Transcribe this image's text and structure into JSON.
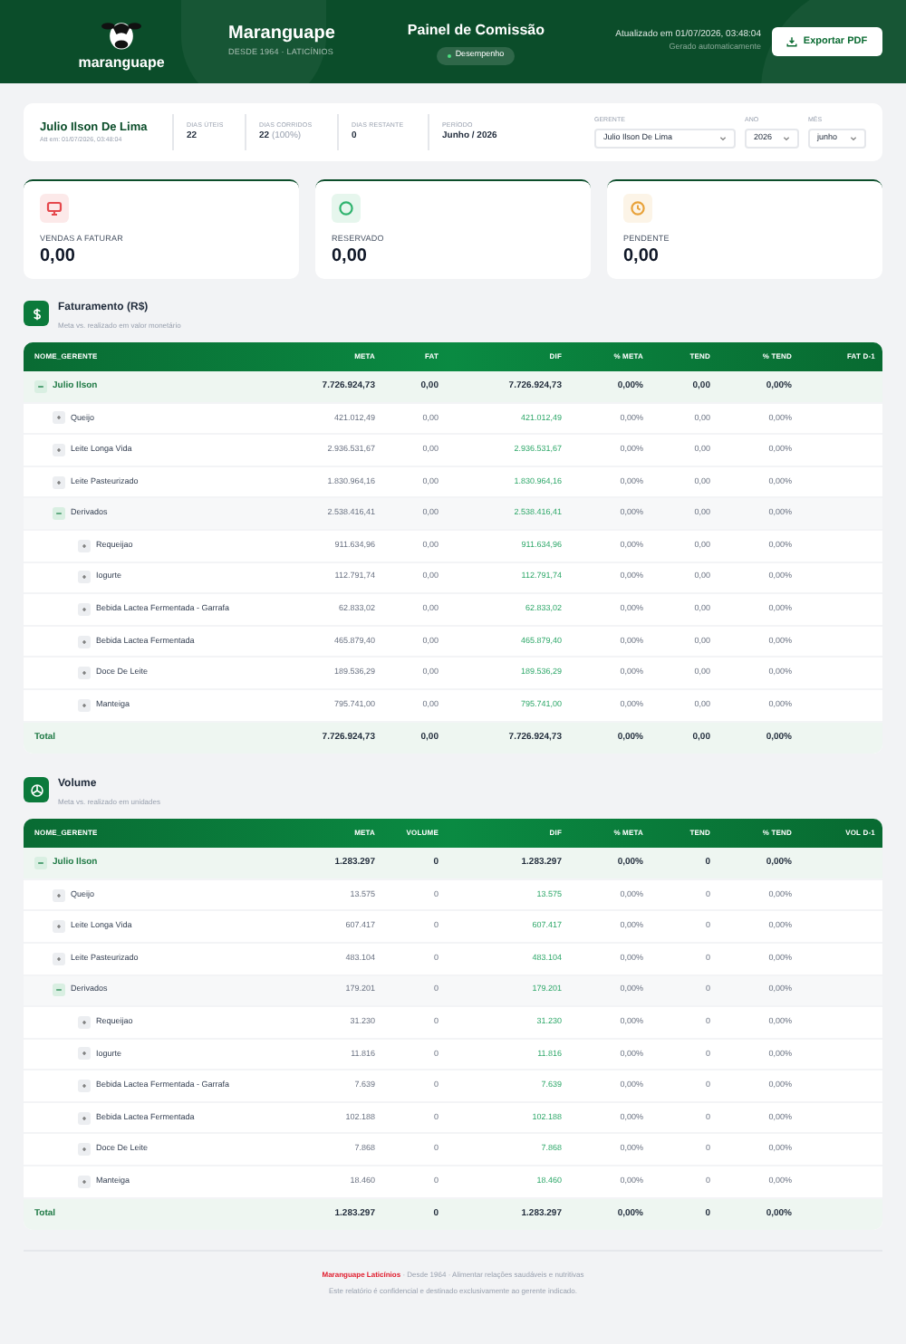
{
  "header": {
    "logo_text": "maranguape",
    "title": "Maranguape",
    "subtitle": "DESDE 1964 · LATICÍNIOS",
    "center_title": "Painel de Comissão",
    "pill": "Desempenho",
    "updated": "Atualizado em 01/07/2026, 03:48:04",
    "generated": "Gerado automaticamente",
    "export_button": "Exportar PDF"
  },
  "info": {
    "name": "Julio Ilson De Lima",
    "updated": "Att em: 01/07/2026, 03:48:04",
    "stats": [
      {
        "label": "DIAS ÚTEIS",
        "value": "22"
      },
      {
        "label": "DIAS CORRIDOS",
        "value": "22",
        "note": "(100%)"
      },
      {
        "label": "DIAS RESTANTE",
        "value": "0"
      },
      {
        "label": "PERÍODO",
        "value": "Junho / 2026"
      }
    ],
    "filters": [
      {
        "label": "GERENTE",
        "value": "Julio Ilson De Lima"
      },
      {
        "label": "ANO",
        "value": "2026"
      },
      {
        "label": "MÊS",
        "value": "junho"
      }
    ]
  },
  "kpis": [
    {
      "kind": "monitor",
      "color": "#e5484d",
      "label": "VENDAS A FATURAR",
      "value": "0,00"
    },
    {
      "kind": "circle",
      "color": "#2fb36e",
      "label": "RESERVADO",
      "value": "0,00"
    },
    {
      "kind": "clock",
      "color": "#e8a23a",
      "label": "PENDENTE",
      "value": "0,00"
    }
  ],
  "tables": [
    {
      "kind": "money",
      "title": "Faturamento (R$)",
      "subtitle": "Meta vs. realizado em valor monetário",
      "columns": [
        "NOME_GERENTE",
        "META",
        "FAT",
        "DIF",
        "% META",
        "TEND",
        "% TEND",
        "FAT D-1"
      ],
      "rows": [
        {
          "name": "Julio Ilson",
          "expanded": true,
          "values": [
            "7.726.924,73",
            "0,00",
            "7.726.924,73",
            "0,00%",
            "0,00",
            "0,00%"
          ],
          "children": [
            {
              "name": "Queijo",
              "expanded": false,
              "values": [
                "421.012,49",
                "0,00",
                "421.012,49",
                "0,00%",
                "0,00",
                "0,00%"
              ]
            },
            {
              "name": "Leite Longa Vida",
              "expanded": false,
              "values": [
                "2.936.531,67",
                "0,00",
                "2.936.531,67",
                "0,00%",
                "0,00",
                "0,00%"
              ]
            },
            {
              "name": "Leite Pasteurizado",
              "expanded": false,
              "values": [
                "1.830.964,16",
                "0,00",
                "1.830.964,16",
                "0,00%",
                "0,00",
                "0,00%"
              ]
            },
            {
              "name": "Derivados",
              "expanded": true,
              "values": [
                "2.538.416,41",
                "0,00",
                "2.538.416,41",
                "0,00%",
                "0,00",
                "0,00%"
              ],
              "children": [
                {
                  "name": "Requeijao",
                  "expanded": false,
                  "values": [
                    "911.634,96",
                    "0,00",
                    "911.634,96",
                    "0,00%",
                    "0,00",
                    "0,00%"
                  ]
                },
                {
                  "name": "Iogurte",
                  "expanded": false,
                  "values": [
                    "112.791,74",
                    "0,00",
                    "112.791,74",
                    "0,00%",
                    "0,00",
                    "0,00%"
                  ]
                },
                {
                  "name": "Bebida Lactea Fermentada - Garrafa",
                  "expanded": false,
                  "values": [
                    "62.833,02",
                    "0,00",
                    "62.833,02",
                    "0,00%",
                    "0,00",
                    "0,00%"
                  ]
                },
                {
                  "name": "Bebida Lactea Fermentada",
                  "expanded": false,
                  "values": [
                    "465.879,40",
                    "0,00",
                    "465.879,40",
                    "0,00%",
                    "0,00",
                    "0,00%"
                  ]
                },
                {
                  "name": "Doce De Leite",
                  "expanded": false,
                  "values": [
                    "189.536,29",
                    "0,00",
                    "189.536,29",
                    "0,00%",
                    "0,00",
                    "0,00%"
                  ]
                },
                {
                  "name": "Manteiga",
                  "expanded": false,
                  "values": [
                    "795.741,00",
                    "0,00",
                    "795.741,00",
                    "0,00%",
                    "0,00",
                    "0,00%"
                  ]
                }
              ]
            }
          ]
        }
      ],
      "total": {
        "label": "Total",
        "values": [
          "7.726.924,73",
          "0,00",
          "7.726.924,73",
          "0,00%",
          "0,00",
          "0,00%"
        ]
      }
    },
    {
      "kind": "volume",
      "title": "Volume",
      "subtitle": "Meta vs. realizado em unidades",
      "columns": [
        "NOME_GERENTE",
        "META",
        "VOLUME",
        "DIF",
        "% META",
        "TEND",
        "% TEND",
        "VOL D-1"
      ],
      "rows": [
        {
          "name": "Julio Ilson",
          "expanded": true,
          "values": [
            "1.283.297",
            "0",
            "1.283.297",
            "0,00%",
            "0",
            "0,00%"
          ],
          "children": [
            {
              "name": "Queijo",
              "expanded": false,
              "values": [
                "13.575",
                "0",
                "13.575",
                "0,00%",
                "0",
                "0,00%"
              ]
            },
            {
              "name": "Leite Longa Vida",
              "expanded": false,
              "values": [
                "607.417",
                "0",
                "607.417",
                "0,00%",
                "0",
                "0,00%"
              ]
            },
            {
              "name": "Leite Pasteurizado",
              "expanded": false,
              "values": [
                "483.104",
                "0",
                "483.104",
                "0,00%",
                "0",
                "0,00%"
              ]
            },
            {
              "name": "Derivados",
              "expanded": true,
              "values": [
                "179.201",
                "0",
                "179.201",
                "0,00%",
                "0",
                "0,00%"
              ],
              "children": [
                {
                  "name": "Requeijao",
                  "expanded": false,
                  "values": [
                    "31.230",
                    "0",
                    "31.230",
                    "0,00%",
                    "0",
                    "0,00%"
                  ]
                },
                {
                  "name": "Iogurte",
                  "expanded": false,
                  "values": [
                    "11.816",
                    "0",
                    "11.816",
                    "0,00%",
                    "0",
                    "0,00%"
                  ]
                },
                {
                  "name": "Bebida Lactea Fermentada - Garrafa",
                  "expanded": false,
                  "values": [
                    "7.639",
                    "0",
                    "7.639",
                    "0,00%",
                    "0",
                    "0,00%"
                  ]
                },
                {
                  "name": "Bebida Lactea Fermentada",
                  "expanded": false,
                  "values": [
                    "102.188",
                    "0",
                    "102.188",
                    "0,00%",
                    "0",
                    "0,00%"
                  ]
                },
                {
                  "name": "Doce De Leite",
                  "expanded": false,
                  "values": [
                    "7.868",
                    "0",
                    "7.868",
                    "0,00%",
                    "0",
                    "0,00%"
                  ]
                },
                {
                  "name": "Manteiga",
                  "expanded": false,
                  "values": [
                    "18.460",
                    "0",
                    "18.460",
                    "0,00%",
                    "0",
                    "0,00%"
                  ]
                }
              ]
            }
          ]
        }
      ],
      "total": {
        "label": "Total",
        "values": [
          "1.283.297",
          "0",
          "1.283.297",
          "0,00%",
          "0",
          "0,00%"
        ]
      }
    }
  ],
  "footer": {
    "brand": "Maranguape Laticínios",
    "tagline": "· Desde 1964 · Alimentar relações saudáveis e nutritivas",
    "note": "Este relatório é confidencial e destinado exclusivamente ao gerente indicado."
  }
}
